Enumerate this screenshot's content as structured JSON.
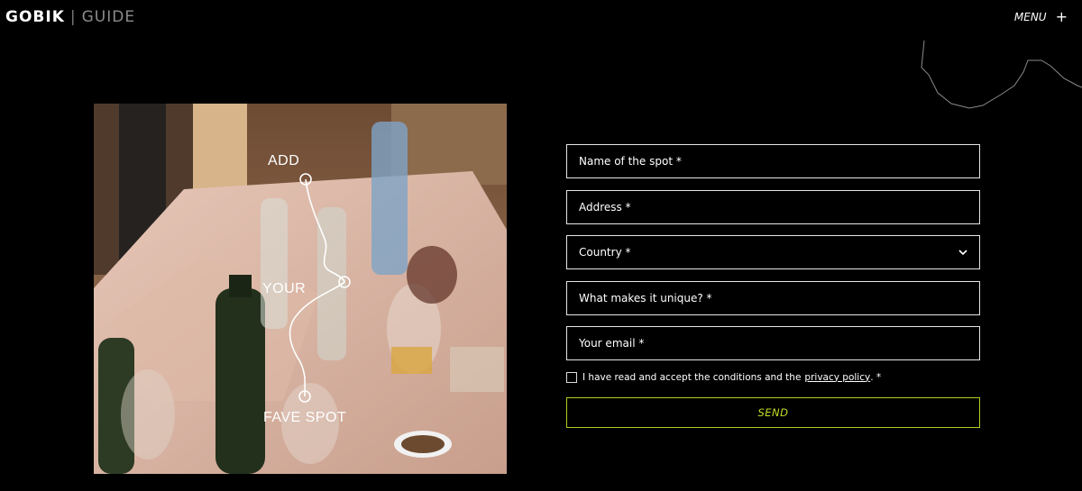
{
  "header": {
    "logo_brand": "GOBIK",
    "logo_separator": "|",
    "logo_guide": "GUIDE",
    "menu_label": "MENU",
    "menu_icon": "plus-icon"
  },
  "hero": {
    "words": [
      "ADD",
      "YOUR",
      "FAVE SPOT"
    ]
  },
  "form": {
    "spot_name_placeholder": "Name of the spot *",
    "address_placeholder": "Address *",
    "country_placeholder": "Country *",
    "unique_placeholder": "What makes it unique? *",
    "email_placeholder": "Your email *",
    "consent_text": "I have read and accept the conditions and the",
    "privacy_link": "privacy policy",
    "consent_suffix": ". *",
    "send_label": "SEND"
  },
  "colors": {
    "background": "#000000",
    "accent": "#c5dd28"
  }
}
